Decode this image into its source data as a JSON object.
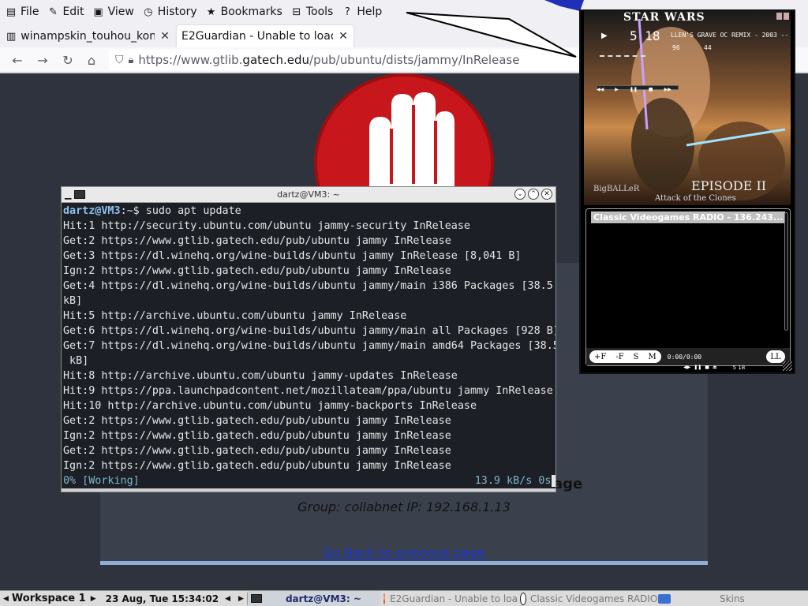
{
  "menubar": {
    "items": [
      {
        "label": "File",
        "icon": "file-icon"
      },
      {
        "label": "Edit",
        "icon": "pencil-icon"
      },
      {
        "label": "View",
        "icon": "view-icon"
      },
      {
        "label": "History",
        "icon": "clock-icon"
      },
      {
        "label": "Bookmarks",
        "icon": "star-icon"
      },
      {
        "label": "Tools",
        "icon": "toolbox-icon"
      },
      {
        "label": "Help",
        "icon": "help-icon"
      }
    ]
  },
  "tabs": [
    {
      "label": "winampskin_touhou_kon"
    },
    {
      "label": "E2Guardian - Unable to load"
    }
  ],
  "navbar": {
    "url_prefix": "https://www.gtlib.",
    "url_host": "gatech.edu",
    "url_path": "/pub/ubuntu/dists/jammy/InRelease"
  },
  "page": {
    "group_line": "Group: collabnet    IP: 192.168.1.13",
    "back_link": "Go Back to previous page",
    "partial_heading": "age"
  },
  "terminal": {
    "title": "dartz@VM3: ~",
    "prompt_user": "dartz@VM3",
    "prompt_rest": ":~$ sudo apt update",
    "lines": [
      "Hit:1 http://security.ubuntu.com/ubuntu jammy-security InRelease",
      "Get:2 https://www.gtlib.gatech.edu/pub/ubuntu jammy InRelease",
      "Get:3 https://dl.winehq.org/wine-builds/ubuntu jammy InRelease [8,041 B]",
      "Ign:2 https://www.gtlib.gatech.edu/pub/ubuntu jammy InRelease",
      "Get:4 https://dl.winehq.org/wine-builds/ubuntu jammy/main i386 Packages [38.5",
      "kB]",
      "Hit:5 http://archive.ubuntu.com/ubuntu jammy InRelease",
      "Get:6 https://dl.winehq.org/wine-builds/ubuntu jammy/main all Packages [928 B]",
      "Get:7 https://dl.winehq.org/wine-builds/ubuntu jammy/main amd64 Packages [38.5",
      " kB]",
      "Hit:8 http://archive.ubuntu.com/ubuntu jammy-updates InRelease",
      "Hit:9 https://ppa.launchpadcontent.net/mozillateam/ppa/ubuntu jammy InRelease",
      "Hit:10 http://archive.ubuntu.com/ubuntu jammy-backports InRelease",
      "Get:2 https://www.gtlib.gatech.edu/pub/ubuntu jammy InRelease",
      "Ign:2 https://www.gtlib.gatech.edu/pub/ubuntu jammy InRelease",
      "Get:2 https://www.gtlib.gatech.edu/pub/ubuntu jammy InRelease",
      "Ign:2 https://www.gtlib.gatech.edu/pub/ubuntu jammy InRelease"
    ],
    "status_left": "0% [Working]",
    "status_right": "13.9 kB/s 0s"
  },
  "player": {
    "logo": "STAR WARS",
    "time": "5 18",
    "ticker": "LLEN'S GRAVE OC REMIX - 2003 --",
    "kbps": "96",
    "khz": "44",
    "episode": "EPISODE II",
    "tagline": "Attack of the Clones",
    "signature": "BigBALLeR",
    "playlist_item": "Classic Videogames RADIO - 136.243....",
    "btn_add": "+F",
    "btn_rem": "-F",
    "btn_sel": "S",
    "btn_misc": "M",
    "pl_time": "0:00/0:00",
    "pl_time2": "5 18",
    "btn_list": "LL"
  },
  "taskbar": {
    "workspace": "Workspace 1",
    "datetime": "23 Aug, Tue 15:34:02",
    "tasks": [
      {
        "label": "dartz@VM3: ~",
        "icon": "terminal-icon"
      },
      {
        "label": "E2Guardian - Unable to loa",
        "icon": "firefox-icon"
      },
      {
        "label": "Classic Videogames RADIO",
        "icon": "winamp-icon"
      },
      {
        "label": "Skins",
        "icon": "folder-icon"
      }
    ]
  },
  "colors": {
    "page_bg": "#2e333d",
    "stop_red": "#c8171c",
    "terminal_bg": "#1c1f26",
    "prompt": "#8ec1f0",
    "link": "#1a34d8"
  }
}
